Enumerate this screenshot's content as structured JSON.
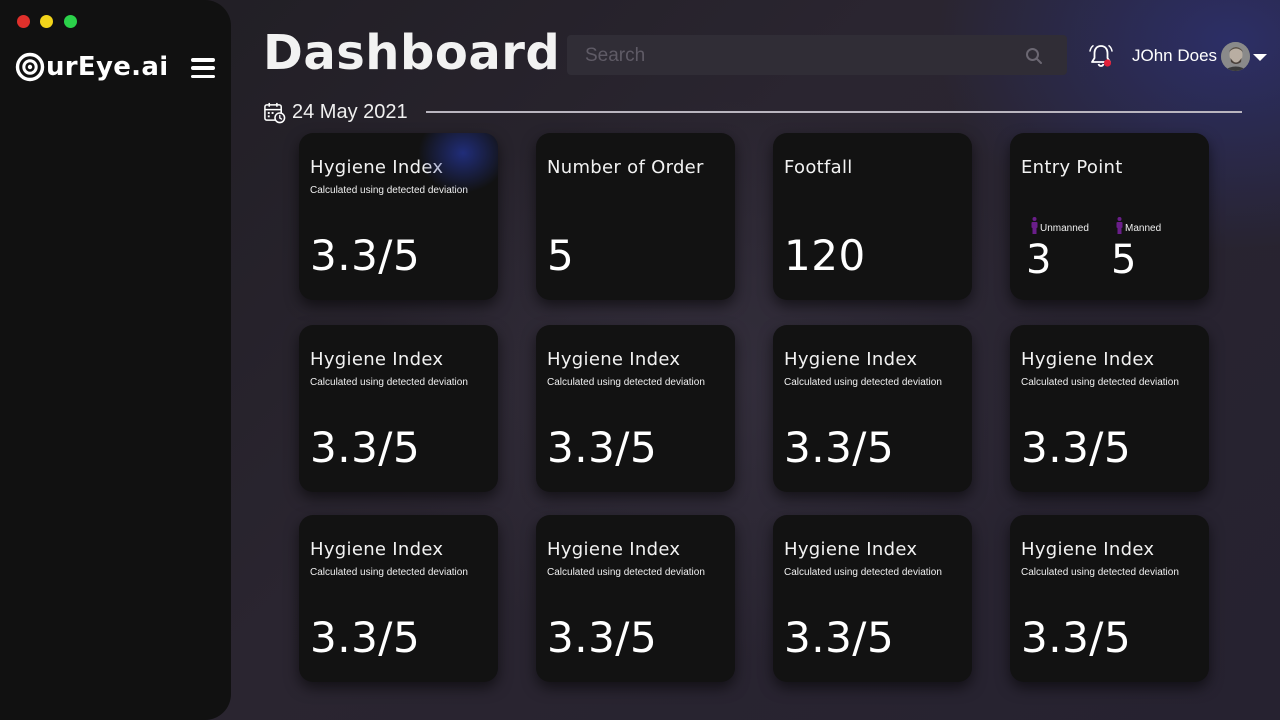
{
  "app": {
    "logo_text": "urEye.ai"
  },
  "header": {
    "title": "Dashboard",
    "search_placeholder": "Search",
    "user_name": "JOhn Does"
  },
  "date": "24 May 2021",
  "cards": {
    "hygiene_top": {
      "title": "Hygiene Index",
      "subtitle": "Calculated using detected deviation",
      "value": "3.3/5"
    },
    "orders": {
      "title": "Number of Order",
      "value": "5"
    },
    "footfall": {
      "title": "Footfall",
      "value": "120"
    },
    "entry_point": {
      "title": "Entry Point",
      "unmanned_label": "Unmanned",
      "unmanned_value": "3",
      "manned_label": "Manned",
      "manned_value": "5"
    },
    "hygiene_grid": [
      {
        "title": "Hygiene Index",
        "subtitle": "Calculated using detected deviation",
        "value": "3.3/5"
      },
      {
        "title": "Hygiene Index",
        "subtitle": "Calculated using detected deviation",
        "value": "3.3/5"
      },
      {
        "title": "Hygiene Index",
        "subtitle": "Calculated using detected deviation",
        "value": "3.3/5"
      },
      {
        "title": "Hygiene Index",
        "subtitle": "Calculated using detected deviation",
        "value": "3.3/5"
      },
      {
        "title": "Hygiene Index",
        "subtitle": "Calculated using detected deviation",
        "value": "3.3/5"
      },
      {
        "title": "Hygiene Index",
        "subtitle": "Calculated using detected deviation",
        "value": "3.3/5"
      },
      {
        "title": "Hygiene Index",
        "subtitle": "Calculated using detected deviation",
        "value": "3.3/5"
      },
      {
        "title": "Hygiene Index",
        "subtitle": "Calculated using detected deviation",
        "value": "3.3/5"
      }
    ]
  },
  "colors": {
    "sidebar_bg": "#111111",
    "card_bg": "#121212",
    "notification_dot": "#e0203a",
    "person_icon": "#6a1e8a",
    "traffic_red": "#e0302b",
    "traffic_yellow": "#f2d41a",
    "traffic_green": "#2bd24a"
  },
  "icons": {
    "menu": "hamburger-icon",
    "search": "search-icon",
    "notifications": "bell-icon",
    "date": "calendar-icon",
    "entry_point": "person-icon"
  }
}
